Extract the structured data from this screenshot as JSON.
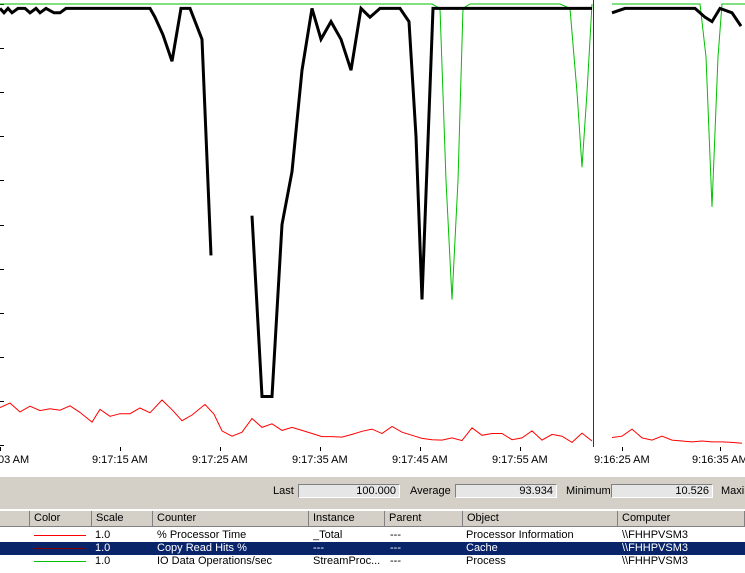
{
  "chart_data": {
    "type": "line",
    "x_ticks": [
      "03 AM",
      "9:17:15 AM",
      "9:17:25 AM",
      "9:17:35 AM",
      "9:17:45 AM",
      "9:17:55 AM",
      "9:16:25 AM",
      "9:16:35 AM"
    ],
    "ylim": [
      0,
      100
    ],
    "grid": true,
    "series": [
      {
        "name": "% Processor Time",
        "color": "#000000",
        "width": 3,
        "values": [
          {
            "x": 0,
            "y": 99
          },
          {
            "x": 4,
            "y": 98
          },
          {
            "x": 8,
            "y": 99
          },
          {
            "x": 12,
            "y": 98
          },
          {
            "x": 18,
            "y": 99
          },
          {
            "x": 25,
            "y": 99
          },
          {
            "x": 30,
            "y": 98
          },
          {
            "x": 36,
            "y": 99
          },
          {
            "x": 40,
            "y": 98
          },
          {
            "x": 46,
            "y": 99
          },
          {
            "x": 54,
            "y": 98
          },
          {
            "x": 60,
            "y": 98
          },
          {
            "x": 66,
            "y": 99
          },
          {
            "x": 72,
            "y": 99
          },
          {
            "x": 80,
            "y": 99
          },
          {
            "x": 90,
            "y": 99
          },
          {
            "x": 100,
            "y": 99
          },
          {
            "x": 110,
            "y": 99
          },
          {
            "x": 120,
            "y": 99
          },
          {
            "x": 130,
            "y": 99
          },
          {
            "x": 140,
            "y": 99
          },
          {
            "x": 150,
            "y": 99
          },
          {
            "x": 155,
            "y": 97
          },
          {
            "x": 163,
            "y": 93
          },
          {
            "x": 172,
            "y": 87
          },
          {
            "x": 181,
            "y": 99
          },
          {
            "x": 190,
            "y": 99
          },
          {
            "x": 202,
            "y": 92
          },
          {
            "x": 211,
            "y": 43
          },
          null,
          {
            "x": 252,
            "y": 52
          },
          {
            "x": 262,
            "y": 11
          },
          {
            "x": 272,
            "y": 11
          },
          {
            "x": 282,
            "y": 50
          },
          {
            "x": 292,
            "y": 62
          },
          {
            "x": 302,
            "y": 85
          },
          {
            "x": 312,
            "y": 99
          },
          {
            "x": 321,
            "y": 92
          },
          {
            "x": 331,
            "y": 96
          },
          {
            "x": 341,
            "y": 92
          },
          {
            "x": 351,
            "y": 85
          },
          {
            "x": 361,
            "y": 99
          },
          {
            "x": 370,
            "y": 97
          },
          {
            "x": 380,
            "y": 99
          },
          {
            "x": 390,
            "y": 99
          },
          {
            "x": 400,
            "y": 99
          },
          {
            "x": 409,
            "y": 96
          },
          {
            "x": 416,
            "y": 70
          },
          {
            "x": 422,
            "y": 33
          },
          {
            "x": 433,
            "y": 99
          },
          {
            "x": 445,
            "y": 99
          },
          {
            "x": 460,
            "y": 99
          },
          {
            "x": 480,
            "y": 99
          },
          {
            "x": 500,
            "y": 99
          },
          {
            "x": 520,
            "y": 99
          },
          {
            "x": 540,
            "y": 99
          },
          {
            "x": 560,
            "y": 99
          },
          {
            "x": 580,
            "y": 99
          },
          {
            "x": 592,
            "y": 99
          },
          null,
          {
            "x": 612,
            "y": 98
          },
          {
            "x": 625,
            "y": 99
          },
          {
            "x": 640,
            "y": 99
          },
          {
            "x": 660,
            "y": 99
          },
          {
            "x": 680,
            "y": 99
          },
          {
            "x": 695,
            "y": 99
          },
          {
            "x": 705,
            "y": 97
          },
          {
            "x": 712,
            "y": 96
          },
          {
            "x": 720,
            "y": 99
          },
          {
            "x": 732,
            "y": 98
          },
          {
            "x": 741,
            "y": 95
          }
        ]
      },
      {
        "name": "Copy Read Hits %",
        "color": "#ff0000",
        "width": 1,
        "values": [
          {
            "x": 0,
            "y": 8.5
          },
          {
            "x": 10,
            "y": 9.5
          },
          {
            "x": 20,
            "y": 7.5
          },
          {
            "x": 30,
            "y": 8.8
          },
          {
            "x": 40,
            "y": 7.8
          },
          {
            "x": 50,
            "y": 8.2
          },
          {
            "x": 60,
            "y": 7.9
          },
          {
            "x": 70,
            "y": 8.9
          },
          {
            "x": 80,
            "y": 7.4
          },
          {
            "x": 92,
            "y": 5.2
          },
          {
            "x": 100,
            "y": 8.1
          },
          {
            "x": 110,
            "y": 6.5
          },
          {
            "x": 120,
            "y": 7.1
          },
          {
            "x": 130,
            "y": 7.1
          },
          {
            "x": 140,
            "y": 8.4
          },
          {
            "x": 150,
            "y": 7.3
          },
          {
            "x": 162,
            "y": 10.2
          },
          {
            "x": 172,
            "y": 8.0
          },
          {
            "x": 182,
            "y": 5.5
          },
          {
            "x": 192,
            "y": 6.8
          },
          {
            "x": 205,
            "y": 9.2
          },
          {
            "x": 214,
            "y": 7.0
          },
          {
            "x": 222,
            "y": 3.2
          },
          {
            "x": 232,
            "y": 2.0
          },
          {
            "x": 242,
            "y": 2.9
          },
          {
            "x": 252,
            "y": 6.0
          },
          {
            "x": 262,
            "y": 4.0
          },
          {
            "x": 272,
            "y": 4.8
          },
          {
            "x": 282,
            "y": 3.3
          },
          {
            "x": 292,
            "y": 4.0
          },
          {
            "x": 302,
            "y": 3.3
          },
          {
            "x": 312,
            "y": 2.6
          },
          {
            "x": 322,
            "y": 1.9
          },
          {
            "x": 332,
            "y": 1.9
          },
          {
            "x": 342,
            "y": 1.8
          },
          {
            "x": 352,
            "y": 2.4
          },
          {
            "x": 362,
            "y": 3.1
          },
          {
            "x": 372,
            "y": 3.6
          },
          {
            "x": 382,
            "y": 2.6
          },
          {
            "x": 392,
            "y": 4.2
          },
          {
            "x": 402,
            "y": 2.9
          },
          {
            "x": 412,
            "y": 2.2
          },
          {
            "x": 422,
            "y": 1.5
          },
          {
            "x": 432,
            "y": 1.2
          },
          {
            "x": 442,
            "y": 1.1
          },
          {
            "x": 452,
            "y": 1.6
          },
          {
            "x": 462,
            "y": 1.0
          },
          {
            "x": 472,
            "y": 3.9
          },
          {
            "x": 482,
            "y": 2.2
          },
          {
            "x": 492,
            "y": 2.6
          },
          {
            "x": 502,
            "y": 2.6
          },
          {
            "x": 512,
            "y": 1.2
          },
          {
            "x": 522,
            "y": 1.6
          },
          {
            "x": 532,
            "y": 3.2
          },
          {
            "x": 542,
            "y": 1.1
          },
          {
            "x": 552,
            "y": 2.4
          },
          {
            "x": 562,
            "y": 2.0
          },
          {
            "x": 572,
            "y": 0.6
          },
          {
            "x": 582,
            "y": 2.7
          },
          {
            "x": 592,
            "y": 0.9
          },
          null,
          {
            "x": 612,
            "y": 1.7
          },
          {
            "x": 622,
            "y": 2.0
          },
          {
            "x": 632,
            "y": 3.6
          },
          {
            "x": 642,
            "y": 1.6
          },
          {
            "x": 652,
            "y": 1.1
          },
          {
            "x": 662,
            "y": 2.0
          },
          {
            "x": 672,
            "y": 1.1
          },
          {
            "x": 682,
            "y": 0.9
          },
          {
            "x": 692,
            "y": 0.7
          },
          {
            "x": 702,
            "y": 0.9
          },
          {
            "x": 712,
            "y": 0.7
          },
          {
            "x": 722,
            "y": 0.7
          },
          {
            "x": 732,
            "y": 0.6
          },
          {
            "x": 742,
            "y": 0.4
          }
        ]
      },
      {
        "name": "IO Data Operations/sec",
        "color": "#00c000",
        "width": 1,
        "values": [
          {
            "x": 0,
            "y": 100
          },
          {
            "x": 432,
            "y": 100
          },
          {
            "x": 440,
            "y": 99
          },
          {
            "x": 446,
            "y": 60
          },
          {
            "x": 452,
            "y": 33
          },
          {
            "x": 458,
            "y": 60
          },
          {
            "x": 463,
            "y": 99
          },
          {
            "x": 470,
            "y": 100
          },
          {
            "x": 560,
            "y": 100
          },
          {
            "x": 570,
            "y": 99
          },
          {
            "x": 577,
            "y": 80
          },
          {
            "x": 582,
            "y": 63
          },
          {
            "x": 587,
            "y": 80
          },
          {
            "x": 592,
            "y": 100
          },
          null,
          {
            "x": 612,
            "y": 100
          },
          {
            "x": 700,
            "y": 100
          },
          {
            "x": 706,
            "y": 88
          },
          {
            "x": 712,
            "y": 54
          },
          {
            "x": 718,
            "y": 88
          },
          {
            "x": 722,
            "y": 100
          },
          {
            "x": 745,
            "y": 100
          }
        ]
      }
    ],
    "time_bar_x": 593
  },
  "stats": {
    "last_label": "Last",
    "last_value": "100.000",
    "avg_label": "Average",
    "avg_value": "93.934",
    "min_label": "Minimum",
    "min_value": "10.526",
    "max_label": "Maxi"
  },
  "legend": {
    "headers": [
      "Color",
      "Scale",
      "Counter",
      "Instance",
      "Parent",
      "Object",
      "Computer"
    ],
    "rows": [
      {
        "color": "#ff0000",
        "scale": "1.0",
        "counter": "% Processor Time",
        "instance": "_Total",
        "parent": "---",
        "object": "Processor Information",
        "computer": "\\\\FHHPVSM3",
        "selected": false
      },
      {
        "color": "#800000",
        "scale": "1.0",
        "counter": "Copy Read Hits %",
        "instance": "---",
        "parent": "---",
        "object": "Cache",
        "computer": "\\\\FHHPVSM3",
        "selected": true
      },
      {
        "color": "#00c000",
        "scale": "1.0",
        "counter": "IO Data Operations/sec",
        "instance": "StreamProc...",
        "parent": "---",
        "object": "Process",
        "computer": "\\\\FHHPVSM3",
        "selected": false
      }
    ]
  }
}
